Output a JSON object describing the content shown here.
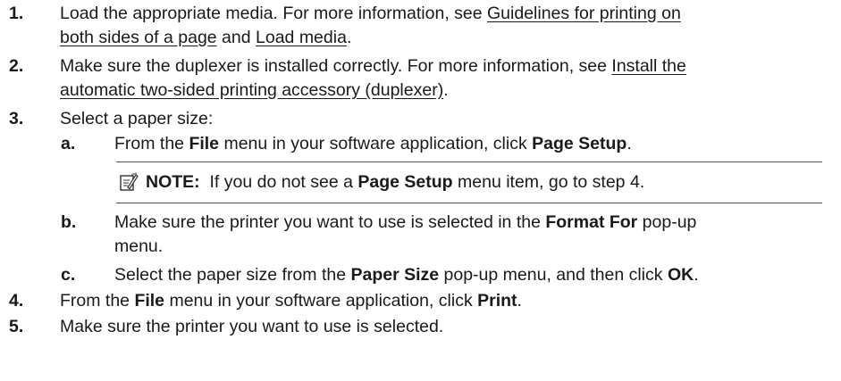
{
  "steps": [
    {
      "number": "1.",
      "line1_pre": "Load the appropriate media. For more information, see ",
      "link1": "Guidelines for printing on",
      "link1b": "both sides of a page",
      "line2_mid": " and ",
      "link2": "Load media",
      "line2_end": "."
    },
    {
      "number": "2.",
      "line1_pre": "Make sure the duplexer is installed correctly. For more information, see ",
      "link1": "Install the",
      "link1b": "automatic two-sided printing accessory (duplexer)",
      "line2_end": "."
    },
    {
      "number": "3.",
      "text": "Select a paper size:",
      "substeps": [
        {
          "letter": "a",
          "t1": "From the ",
          "b1": "File",
          "t2": " menu in your software application, click ",
          "b2": "Page Setup",
          "t3": "."
        },
        {
          "letter": "b",
          "t1": "Make sure the printer you want to use is selected in the ",
          "b1": "Format For",
          "t2": " pop-up",
          "t3": "menu."
        },
        {
          "letter": "c",
          "t1": "Select the paper size from the ",
          "b1": "Paper Size",
          "t2": " pop-up menu, and then click ",
          "b2": "OK",
          "t3": "."
        }
      ]
    },
    {
      "number": "4.",
      "t1": "From the ",
      "b1": "File",
      "t2": " menu in your software application, click ",
      "b2": "Print",
      "t3": "."
    },
    {
      "number": "5.",
      "text": "Make sure the printer you want to use is selected."
    }
  ],
  "note": {
    "icon": "note-pencil-icon",
    "label": "NOTE:",
    "t1": "If you do not see a ",
    "b1": "Page Setup",
    "t2": " menu item, go to step 4."
  }
}
